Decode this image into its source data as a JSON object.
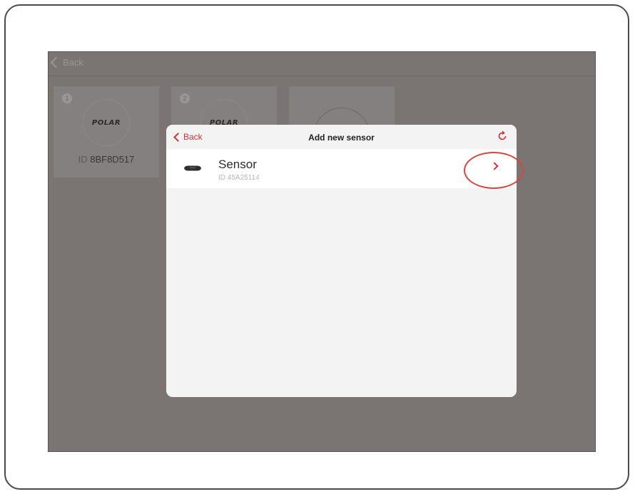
{
  "topbar": {
    "back_label": "Back"
  },
  "cards": [
    {
      "index": "1",
      "logo": "POLAR",
      "id_prefix": "ID",
      "id_value": "8BF8D517"
    },
    {
      "index": "2",
      "logo": "POLAR"
    },
    {
      "type": "add"
    }
  ],
  "modal": {
    "back_label": "Back",
    "title": "Add new sensor",
    "refresh_icon": "refresh-icon",
    "sensors": [
      {
        "name": "Sensor",
        "id": "ID 45A25114",
        "icon": "heart-rate-strap-icon"
      }
    ]
  },
  "colors": {
    "accent": "#d0343a",
    "overlay": "#7a7472",
    "highlight": "#d8473f"
  }
}
